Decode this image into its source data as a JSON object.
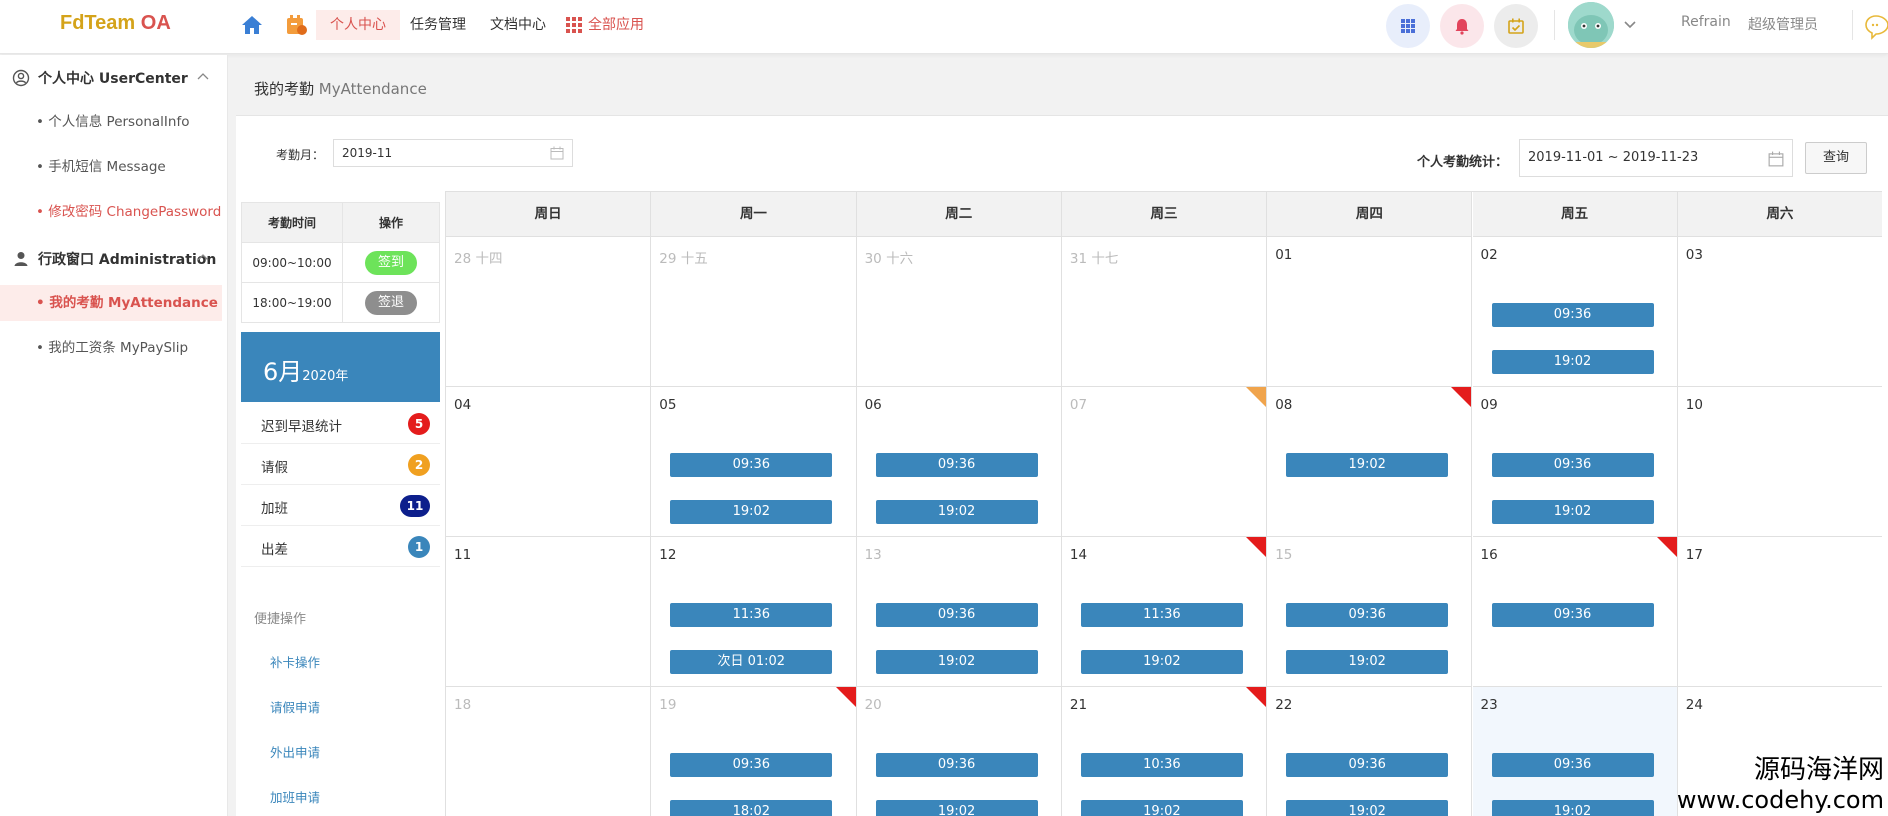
{
  "header": {
    "logo_part1": "FdTeam",
    "logo_part2": " OA",
    "nav": [
      {
        "label": "个人中心"
      },
      {
        "label": "任务管理"
      },
      {
        "label": "文档中心"
      },
      {
        "label": "全部应用"
      }
    ],
    "user_name": "Refrain",
    "user_role": "超级管理员",
    "colors": {
      "accent": "#d9534f",
      "primary": "#3a86bb"
    }
  },
  "sidebar": {
    "groups": [
      {
        "label": "个人中心 UserCenter",
        "icon": "user-circle-icon",
        "items": [
          {
            "label": "• 个人信息 PersonalInfo"
          },
          {
            "label": "• 手机短信 Message"
          },
          {
            "label": "• 修改密码 ChangePassword"
          }
        ]
      },
      {
        "label": "行政窗口 Administration",
        "icon": "person-icon",
        "items": [
          {
            "label": "• 我的考勤 MyAttendance"
          },
          {
            "label": "• 我的工资条 MyPaySlip"
          }
        ]
      }
    ]
  },
  "page": {
    "title": "我的考勤",
    "title_en": " MyAttendance",
    "month_label": "考勤月：",
    "month_value": "2019-11",
    "stat_label": "个人考勤统计：",
    "stat_range": "2019-11-01 ~ 2019-11-23",
    "query_button": "查询"
  },
  "attendance": {
    "headers": [
      "考勤时间",
      "操作"
    ],
    "rows": [
      {
        "time": "09:00~10:00",
        "action": "签到"
      },
      {
        "time": "18:00~19:00",
        "action": "签退"
      }
    ]
  },
  "month_box": {
    "month": "6月",
    "year": "2020年"
  },
  "stats": [
    {
      "label": "迟到早退统计",
      "count": "5",
      "color": "#e41c1c"
    },
    {
      "label": "请假",
      "count": "2",
      "color": "#f0a020"
    },
    {
      "label": "加班",
      "count": "11",
      "color": "#0d1f8c"
    },
    {
      "label": "出差",
      "count": "1",
      "color": "#3a86bb"
    }
  ],
  "quick": {
    "title": "便捷操作",
    "links": [
      "补卡操作",
      "请假申请",
      "外出申请",
      "加班申请"
    ]
  },
  "calendar": {
    "weekdays": [
      "周日",
      "周一",
      "周二",
      "周三",
      "周四",
      "周五",
      "周六"
    ],
    "weeks": [
      [
        {
          "d": "28 十四",
          "dim": true,
          "ev": []
        },
        {
          "d": "29 十五",
          "dim": true,
          "ev": []
        },
        {
          "d": "30 十六",
          "dim": true,
          "ev": []
        },
        {
          "d": "31 十七",
          "dim": true,
          "ev": []
        },
        {
          "d": "01",
          "ev": []
        },
        {
          "d": "02",
          "ev": [
            "09:36",
            "19:02"
          ]
        },
        {
          "d": "03",
          "ev": []
        }
      ],
      [
        {
          "d": "04",
          "ev": []
        },
        {
          "d": "05",
          "ev": [
            "09:36",
            "19:02"
          ]
        },
        {
          "d": "06",
          "ev": [
            "09:36",
            "19:02"
          ]
        },
        {
          "d": "07",
          "dim": true,
          "ev": [],
          "flag": "orange"
        },
        {
          "d": "08",
          "ev": [
            "19:02"
          ],
          "flag": "red"
        },
        {
          "d": "09",
          "ev": [
            "09:36",
            "19:02"
          ]
        },
        {
          "d": "10",
          "ev": []
        }
      ],
      [
        {
          "d": "11",
          "ev": []
        },
        {
          "d": "12",
          "ev": [
            "11:36",
            "次日 01:02"
          ]
        },
        {
          "d": "13",
          "dim": true,
          "ev": [
            "09:36",
            "19:02"
          ]
        },
        {
          "d": "14",
          "ev": [
            "11:36",
            "19:02"
          ],
          "flag": "red"
        },
        {
          "d": "15",
          "dim": true,
          "ev": [
            "09:36",
            "19:02"
          ]
        },
        {
          "d": "16",
          "ev": [
            "09:36"
          ],
          "flag": "red"
        },
        {
          "d": "17",
          "ev": []
        }
      ],
      [
        {
          "d": "18",
          "dim": true,
          "ev": []
        },
        {
          "d": "19",
          "dim": true,
          "ev": [
            "09:36",
            "18:02"
          ],
          "flag": "red"
        },
        {
          "d": "20",
          "dim": true,
          "ev": [
            "09:36",
            "19:02"
          ]
        },
        {
          "d": "21",
          "ev": [
            "10:36",
            "19:02"
          ],
          "flag": "red"
        },
        {
          "d": "22",
          "ev": [
            "09:36",
            "19:02"
          ]
        },
        {
          "d": "23",
          "ev": [
            "09:36",
            "19:02"
          ],
          "today": true
        },
        {
          "d": "24",
          "ev": []
        }
      ]
    ]
  },
  "watermark": {
    "cn": "源码海洋网",
    "url": "www.codehy.com"
  }
}
